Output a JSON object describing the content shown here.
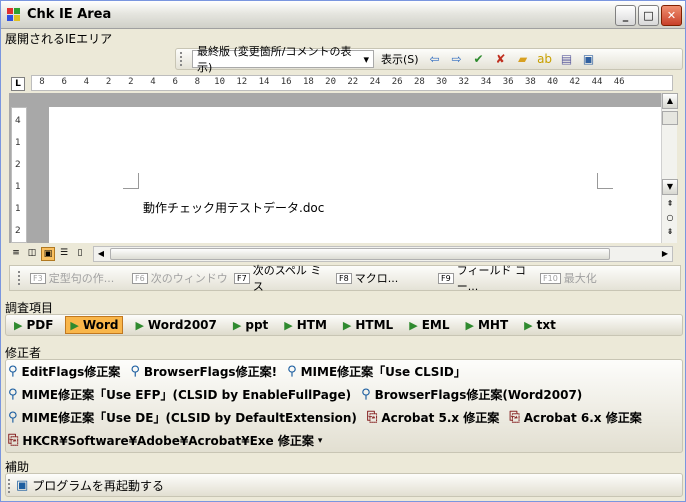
{
  "window": {
    "title": "Chk IE Area",
    "min": "_",
    "max": "□",
    "close": "✕"
  },
  "browser_area_label": "展開されるIEエリア",
  "word_toolbar": {
    "view_select": "最終版 (変更箇所/コメントの表示)",
    "show_label": "表示(S)"
  },
  "ruler": {
    "ticks": [
      "8",
      "6",
      "4",
      "2",
      "2",
      "4",
      "6",
      "8",
      "10",
      "12",
      "14",
      "16",
      "18",
      "20",
      "22",
      "24",
      "26",
      "28",
      "30",
      "32",
      "34",
      "36",
      "38",
      "40",
      "42",
      "44",
      "46"
    ]
  },
  "vruler": {
    "ticks": [
      "4",
      "1",
      "2",
      "1",
      "1",
      "2"
    ]
  },
  "document": {
    "text": "動作チェック用テストデータ.doc"
  },
  "fkeys": [
    {
      "key": "F3",
      "label": "定型句の作...",
      "enabled": false
    },
    {
      "key": "F6",
      "label": "次のウィンドウ",
      "enabled": false
    },
    {
      "key": "F7",
      "label": "次のスペル ミス",
      "enabled": true
    },
    {
      "key": "F8",
      "label": "マクロ...",
      "enabled": true
    },
    {
      "key": "F9",
      "label": "フィールド コー...",
      "enabled": true
    },
    {
      "key": "F10",
      "label": "最大化",
      "enabled": false
    }
  ],
  "survey": {
    "label": "調査項目",
    "items": [
      "PDF",
      "Word",
      "Word2007",
      "ppt",
      "HTM",
      "HTML",
      "EML",
      "MHT",
      "txt"
    ],
    "active": "Word"
  },
  "fixer": {
    "label": "修正者",
    "rows": [
      [
        "EditFlags修正案",
        "BrowserFlags修正案!",
        "MIME修正案「Use CLSID」"
      ],
      [
        "MIME修正案「Use EFP」(CLSID by EnableFullPage)",
        "BrowserFlags修正案(Word2007)"
      ],
      [
        "MIME修正案「Use DE」(CLSID by DefaultExtension)",
        "Acrobat 5.x 修正案",
        "Acrobat 6.x 修正案"
      ],
      [
        "HKCR¥Software¥Adobe¥Acrobat¥Exe 修正案"
      ]
    ]
  },
  "assist": {
    "label": "補助",
    "restart": "プログラムを再起動する"
  }
}
